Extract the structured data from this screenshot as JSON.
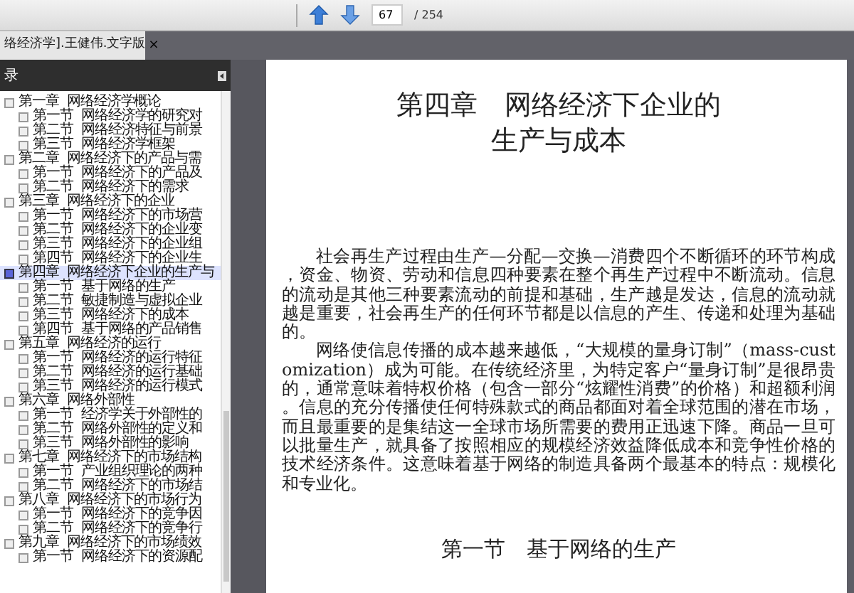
{
  "toolbar": {
    "page_input": "67",
    "page_total": "/ 254"
  },
  "tab": {
    "title": "络经济学].王健伟.文字版",
    "close": "×"
  },
  "sidebar": {
    "title": "录",
    "items": [
      {
        "number": "第一章",
        "title": "网络经济学概论",
        "selected": false,
        "children": [
          {
            "number": "第一节",
            "title": "网络经济学的研究对",
            "selected": false
          },
          {
            "number": "第二节",
            "title": "网络经济特征与前景",
            "selected": false
          },
          {
            "number": "第三节",
            "title": "网络经济学框架",
            "selected": false
          }
        ]
      },
      {
        "number": "第二章",
        "title": "网络经济下的产品与需",
        "selected": false,
        "children": [
          {
            "number": "第一节",
            "title": "网络经济下的产品及",
            "selected": false
          },
          {
            "number": "第二节",
            "title": "网络经济下的需求",
            "selected": false
          }
        ]
      },
      {
        "number": "第三章",
        "title": "网络经济下的企业",
        "selected": false,
        "children": [
          {
            "number": "第一节",
            "title": "网络经济下的市场营",
            "selected": false
          },
          {
            "number": "第二节",
            "title": "网络经济下的企业变",
            "selected": false
          },
          {
            "number": "第三节",
            "title": "网络经济下的企业组",
            "selected": false
          },
          {
            "number": "第四节",
            "title": "网络经济下的企业生",
            "selected": false
          }
        ]
      },
      {
        "number": "第四章",
        "title": "网络经济下企业的生产与",
        "selected": true,
        "children": [
          {
            "number": "第一节",
            "title": "基于网络的生产",
            "selected": false
          },
          {
            "number": "第二节",
            "title": "敏捷制造与虚拟企业",
            "selected": false
          },
          {
            "number": "第三节",
            "title": "网络经济下的成本",
            "selected": false
          },
          {
            "number": "第四节",
            "title": "基于网络的产品销售",
            "selected": false
          }
        ]
      },
      {
        "number": "第五章",
        "title": "网络经济的运行",
        "selected": false,
        "children": [
          {
            "number": "第一节",
            "title": "网络经济的运行特征",
            "selected": false
          },
          {
            "number": "第二节",
            "title": "网络经济的运行基础",
            "selected": false
          },
          {
            "number": "第三节",
            "title": "网络经济的运行模式",
            "selected": false
          }
        ]
      },
      {
        "number": "第六章",
        "title": "网络外部性",
        "selected": false,
        "children": [
          {
            "number": "第一节",
            "title": "经济学关于外部性的",
            "selected": false
          },
          {
            "number": "第二节",
            "title": "网络外部性的定义和",
            "selected": false
          },
          {
            "number": "第三节",
            "title": "网络外部性的影响",
            "selected": false
          }
        ]
      },
      {
        "number": "第七章",
        "title": "网络经济下的市场结构",
        "selected": false,
        "children": [
          {
            "number": "第一节",
            "title": "产业组织理论的两种",
            "selected": false
          },
          {
            "number": "第二节",
            "title": "网络经济下的市场结",
            "selected": false
          }
        ]
      },
      {
        "number": "第八章",
        "title": "网络经济下的市场行为",
        "selected": false,
        "children": [
          {
            "number": "第一节",
            "title": "网络经济下的竞争因",
            "selected": false
          },
          {
            "number": "第二节",
            "title": "网络经济下的竞争行",
            "selected": false
          }
        ]
      },
      {
        "number": "第九章",
        "title": "网络经济下的市场绩效",
        "selected": false,
        "children": [
          {
            "number": "第一节",
            "title": "网络经济下的资源配",
            "selected": false
          }
        ]
      }
    ]
  },
  "document": {
    "title_lines": [
      "第四章　网络经济下企业的",
      "生产与成本"
    ],
    "paragraphs": [
      "社会再生产过程由生产—分配—交换—消费四个不断循环的环节构成，资金、物资、劳动和信息四种要素在整个再生产过程中不断流动。信息的流动是其他三种要素流动的前提和基础，生产越是发达，信息的流动就越是重要，社会再生产的任何环节都是以信息的产生、传递和处理为基础的。",
      "网络使信息传播的成本越来越低，“大规模的量身订制”（mass-customization）成为可能。在传统经济里，为特定客户“量身订制”是很昂贵的，通常意味着特权价格（包含一部分“炫耀性消费”的价格）和超额利润。信息的充分传播使任何特殊款式的商品都面对着全球范围的潜在市场，而且最重要的是集结这一全球市场所需要的费用正迅速下降。商品一旦可以批量生产，就具备了按照相应的规模经济效益降低成本和竞争性价格的技术经济条件。这意味着基于网络的制造具备两个最基本的特点：规模化和专业化。"
    ],
    "section_heading": "第一节　基于网络的生产"
  }
}
